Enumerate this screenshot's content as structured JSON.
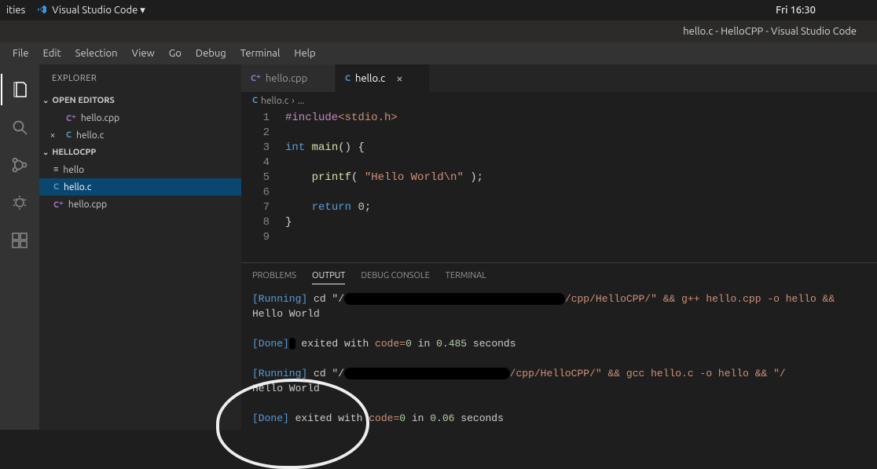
{
  "gnome": {
    "activities": "ities",
    "app_name": "Visual Studio Code",
    "dropdown_glyph": "▾",
    "clock": "Fri 16:30"
  },
  "title": "hello.c - HelloCPP - Visual Studio Code",
  "menu": {
    "file": "File",
    "edit": "Edit",
    "selection": "Selection",
    "view": "View",
    "go": "Go",
    "debug": "Debug",
    "terminal": "Terminal",
    "help": "Help"
  },
  "sidebar": {
    "title": "EXPLORER",
    "open_editors_label": "OPEN EDITORS",
    "project_label": "HELLOCPP",
    "open_editors": [
      {
        "icon": "cpp",
        "name": "hello.cpp",
        "close": ""
      },
      {
        "icon": "c",
        "name": "hello.c",
        "close": "×"
      }
    ],
    "tree": [
      {
        "icon": "lines",
        "name": "hello"
      },
      {
        "icon": "c",
        "name": "hello.c",
        "active": true
      },
      {
        "icon": "cpp",
        "name": "hello.cpp"
      }
    ]
  },
  "tabs": [
    {
      "icon": "cpp",
      "label": "hello.cpp"
    },
    {
      "icon": "c",
      "label": "hello.c",
      "active": true
    }
  ],
  "breadcrumbs": {
    "file_icon": "C",
    "file": "hello.c",
    "sep": "›",
    "trail": "..."
  },
  "code": {
    "lines": [
      {
        "n": "1",
        "html": "<span class='tok-include'>#include</span><span class='tok-string'>&lt;stdio.h&gt;</span>"
      },
      {
        "n": "2",
        "html": ""
      },
      {
        "n": "3",
        "html": "<span class='tok-type'>int</span> <span class='tok-func'>main</span><span class='tok-default'>() {</span>"
      },
      {
        "n": "4",
        "html": ""
      },
      {
        "n": "5",
        "html": "    <span class='tok-func'>printf</span><span class='tok-default'>( </span><span class='tok-string'>\"Hello World\\n\"</span><span class='tok-default'> );</span>"
      },
      {
        "n": "6",
        "html": ""
      },
      {
        "n": "7",
        "html": "    <span class='tok-keyword'>return</span> <span class='tok-num'>0</span><span class='tok-default'>;</span>"
      },
      {
        "n": "8",
        "html": "<span class='tok-default'>}</span>"
      },
      {
        "n": "9",
        "html": ""
      }
    ]
  },
  "panel": {
    "tabs": {
      "problems": "PROBLEMS",
      "output": "OUTPUT",
      "debug_console": "DEBUG CONSOLE",
      "terminal": "TERMINAL"
    },
    "output": {
      "run1_label": "[Running]",
      "run1_cmd_pre": " cd \"/",
      "run1_redact": ".xxxxxxxxxxxxxxxxxxxxxxxxxxxxxxxxxxx",
      "run1_cmd_post": "/cpp/HelloCPP/\" && g++ hello.cpp -o hello && ",
      "hello1": "Hello World",
      "done1_label": "[Done]",
      "done1_mid": " exited with ",
      "done1_code_label": "code=",
      "done1_code_val": "0",
      "done1_in": " in ",
      "done1_time": "0.485",
      "done1_sec": " seconds",
      "done1_redact": "x",
      "run2_label": "[Running]",
      "run2_cmd_pre": " cd \"/",
      "run2_redact": ".xxxxxxx   xxxxxxxxxxx,xxxx",
      "run2_cmd_post": "/cpp/HelloCPP/\" && gcc hello.c -o hello && \"/",
      "hello2": "Hello World",
      "done2_label": "[Done]",
      "done2_mid": " exited with ",
      "done2_code_label": "code=",
      "done2_code_val": "0",
      "done2_in": " in ",
      "done2_time": "0.06",
      "done2_sec": " seconds"
    }
  }
}
